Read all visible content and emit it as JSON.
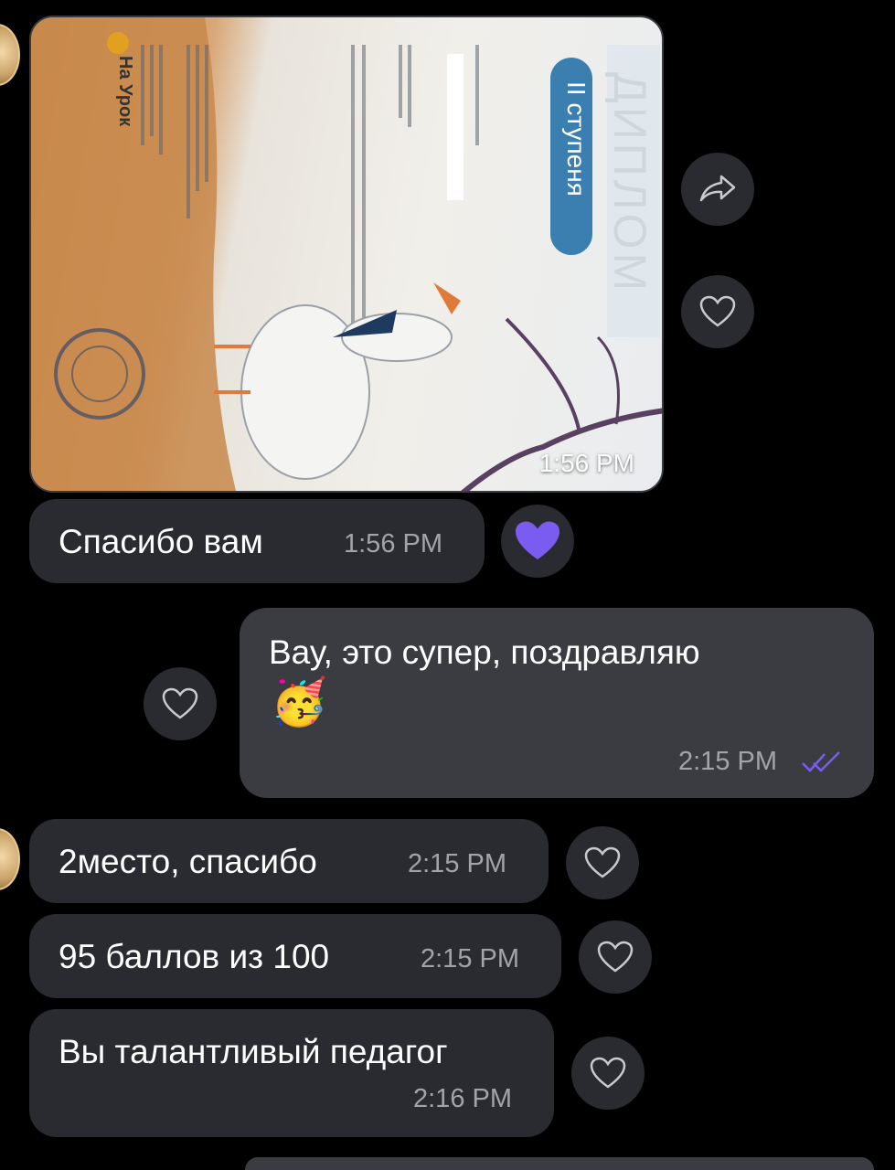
{
  "messages": [
    {
      "type": "photo",
      "sender": "incoming",
      "time": "1:56 PM"
    },
    {
      "type": "text",
      "sender": "incoming",
      "text": "Спасибо вам",
      "time": "1:56 PM",
      "reaction": "purple-heart"
    },
    {
      "type": "text",
      "sender": "outgoing",
      "text": "Вау, это супер, поздравляю",
      "emoji": "🥳",
      "time": "2:15 PM",
      "status": "read"
    },
    {
      "type": "text",
      "sender": "incoming",
      "text": "2место, спасибо",
      "time": "2:15 PM"
    },
    {
      "type": "text",
      "sender": "incoming",
      "text": "95 баллов из 100",
      "time": "2:15 PM"
    },
    {
      "type": "text",
      "sender": "incoming",
      "text": "Вы талантливый педагог",
      "time": "2:16 PM"
    }
  ],
  "photo": {
    "diploma_title": "ДИПЛОМ",
    "degree": "II ступеня",
    "logo": "На Урок"
  },
  "colors": {
    "background": "#000000",
    "incoming_bubble": "#2a2b30",
    "outgoing_bubble": "#3b3c42",
    "accent": "#7b5cf0",
    "time_text": "#a3a4aa"
  },
  "icons": [
    "forward-icon",
    "heart-outline-icon",
    "heart-filled-icon",
    "double-check-icon"
  ]
}
